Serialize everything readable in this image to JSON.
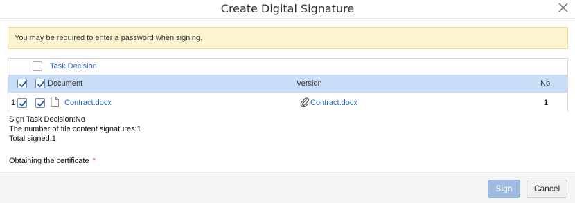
{
  "dialog": {
    "title": "Create Digital Signature"
  },
  "notice": {
    "text": "You may be required to enter a password when signing."
  },
  "table": {
    "task_decision_label": "Task Decision",
    "columns": {
      "document": "Document",
      "version": "Version",
      "no": "No."
    },
    "rows": [
      {
        "index": "1",
        "document": "Contract.docx",
        "version": "Contract.docx",
        "no": "1",
        "row_checked": true,
        "doc_checked": true
      }
    ]
  },
  "summary": {
    "sign_task_decision": "Sign Task Decision:No",
    "file_signatures": "The number of file content signatures:1",
    "total_signed": "Total signed:1"
  },
  "certificate": {
    "label": "Obtaining the certificate",
    "required_marker": "*"
  },
  "buttons": {
    "sign": "Sign",
    "cancel": "Cancel"
  },
  "colors": {
    "header_row": "#c9ddf7",
    "notice_bg": "#fcf3cf",
    "link": "#2765b8",
    "sign_button": "#9fbbe0",
    "required": "#d9221e"
  }
}
